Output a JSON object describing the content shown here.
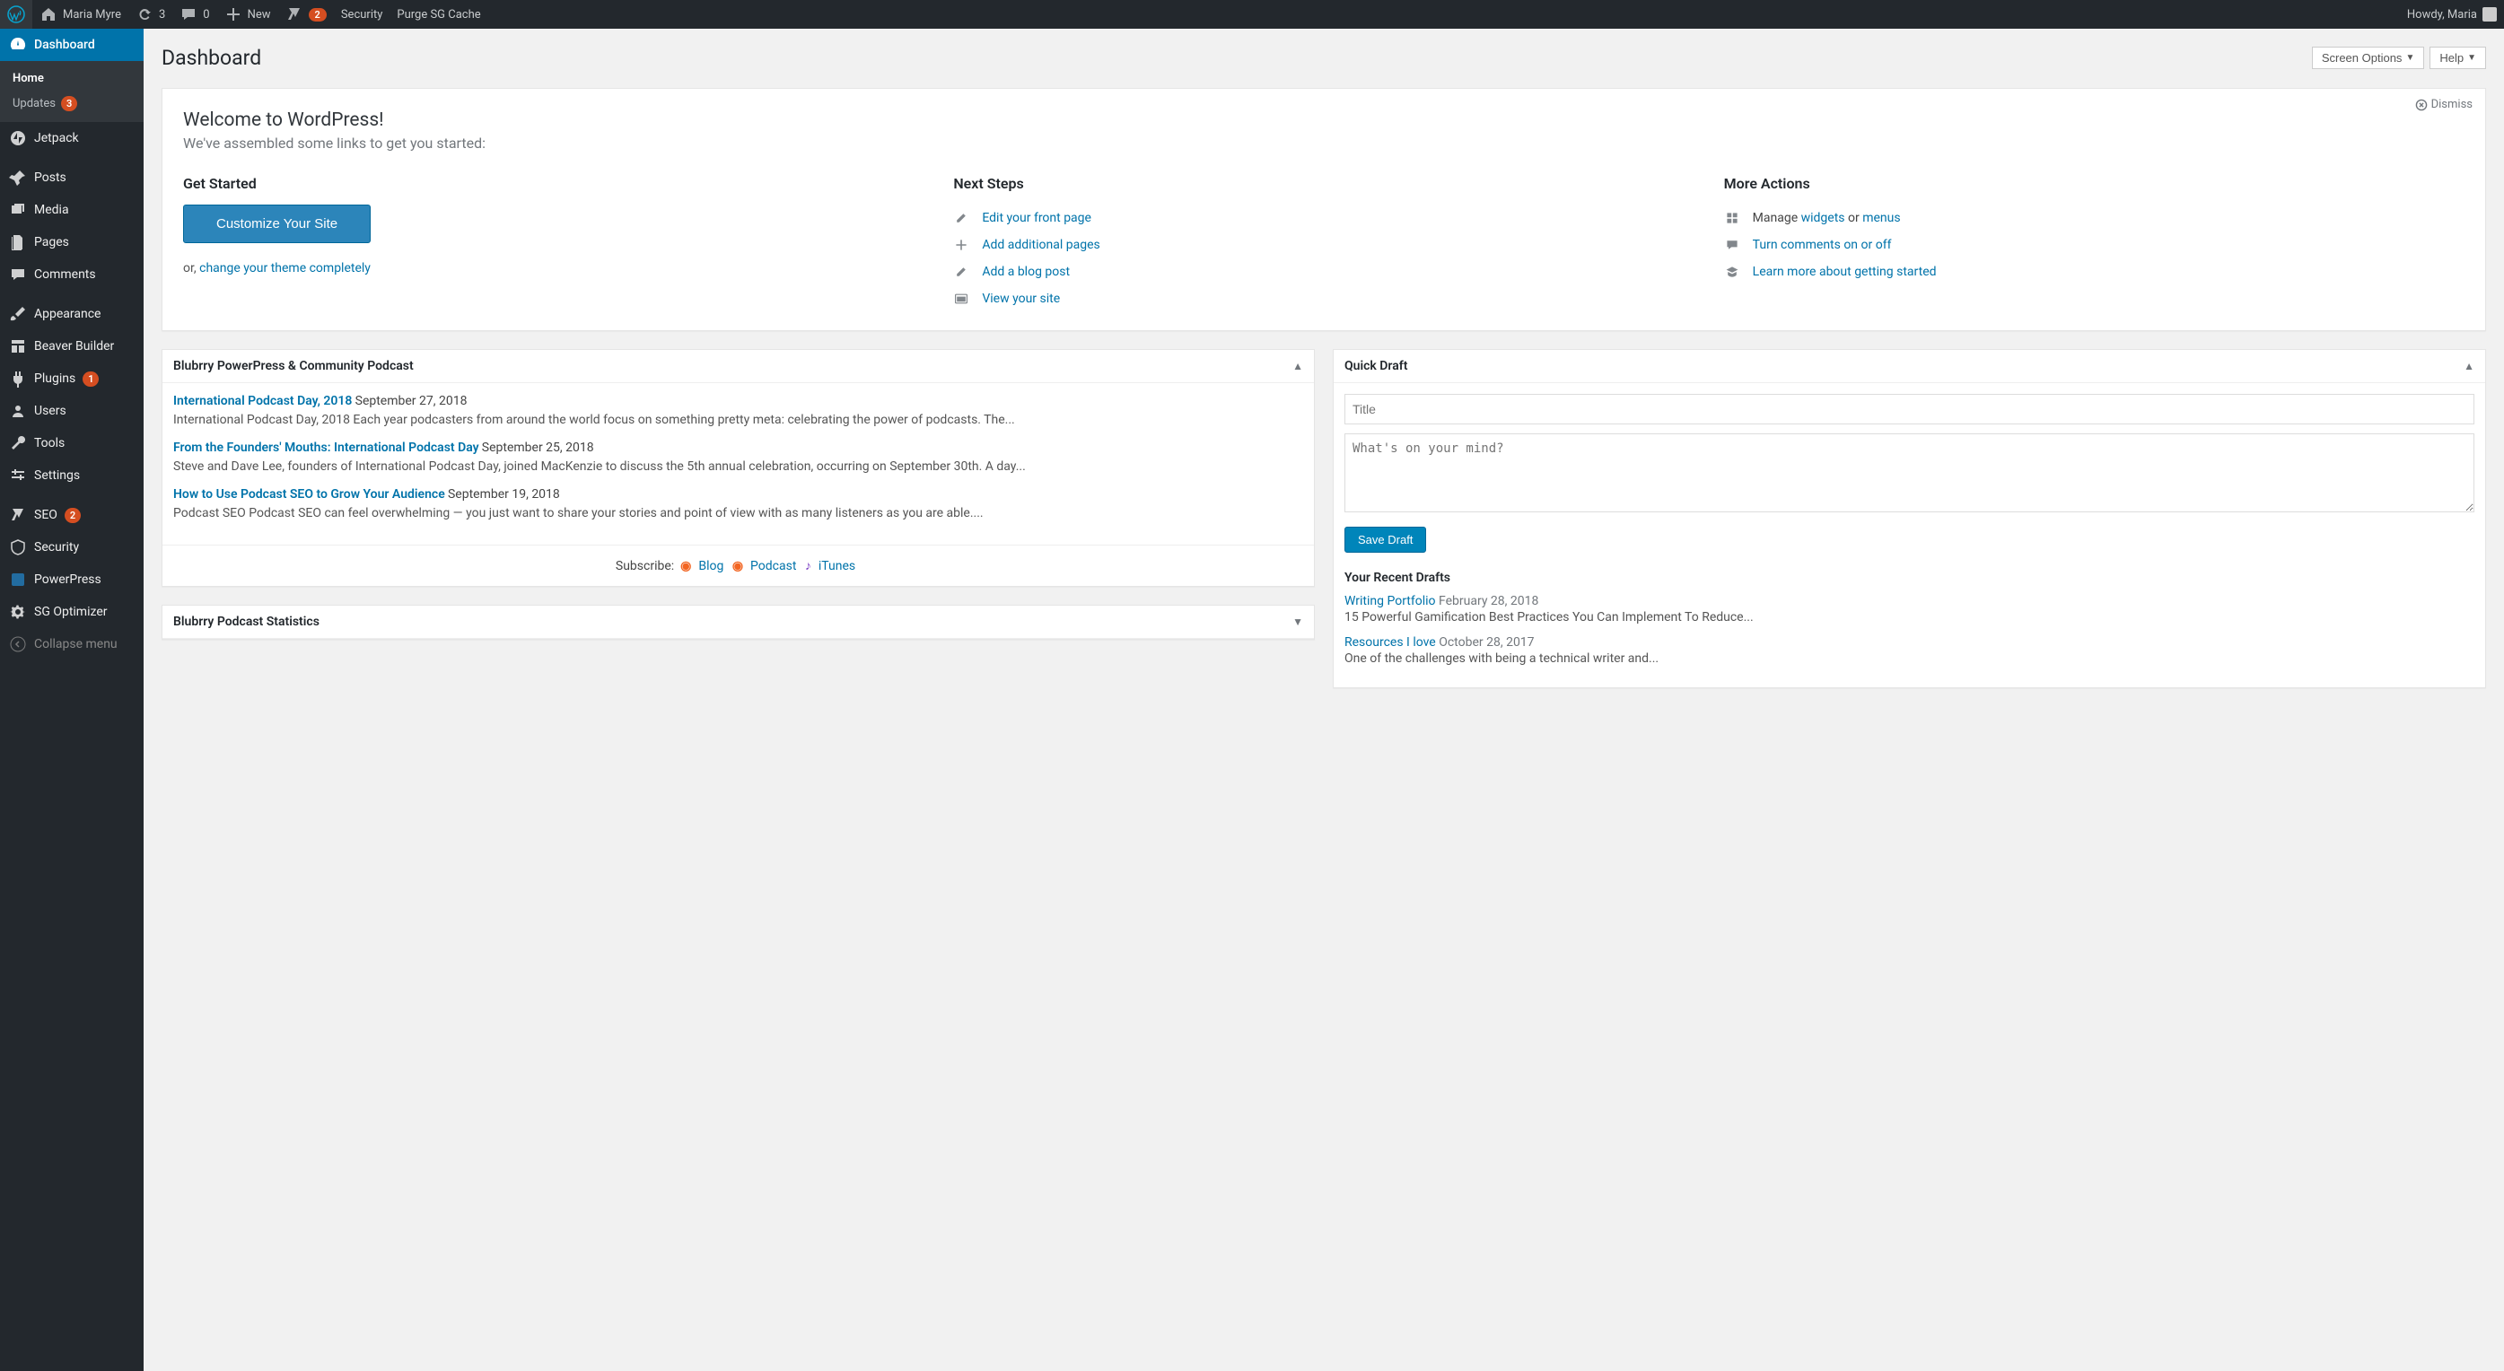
{
  "adminbar": {
    "site_name": "Maria Myre",
    "updates_count": "3",
    "comments_count": "0",
    "new_label": "New",
    "yoast_count": "2",
    "security_label": "Security",
    "purge_label": "Purge SG Cache",
    "howdy": "Howdy, Maria"
  },
  "sidebar": {
    "dashboard": "Dashboard",
    "home": "Home",
    "updates": "Updates",
    "updates_count": "3",
    "jetpack": "Jetpack",
    "posts": "Posts",
    "media": "Media",
    "pages": "Pages",
    "comments": "Comments",
    "appearance": "Appearance",
    "beaver": "Beaver Builder",
    "plugins": "Plugins",
    "plugins_count": "1",
    "users": "Users",
    "tools": "Tools",
    "settings": "Settings",
    "seo": "SEO",
    "seo_count": "2",
    "security2": "Security",
    "powerpress": "PowerPress",
    "sg": "SG Optimizer",
    "collapse": "Collapse menu"
  },
  "header": {
    "title": "Dashboard",
    "screen_options": "Screen Options",
    "help": "Help"
  },
  "welcome": {
    "title": "Welcome to WordPress!",
    "subtitle": "We've assembled some links to get you started:",
    "dismiss": "Dismiss",
    "get_started": "Get Started",
    "customize_btn": "Customize Your Site",
    "or_prefix": "or, ",
    "or_link": "change your theme completely",
    "next_steps": "Next Steps",
    "edit_front": "Edit your front page",
    "add_pages": "Add additional pages",
    "add_post": "Add a blog post",
    "view_site": "View your site",
    "more_actions": "More Actions",
    "manage_prefix": "Manage ",
    "widgets": "widgets",
    "or": " or ",
    "menus": "menus",
    "comments_toggle": "Turn comments on or off",
    "learn_more": "Learn more about getting started"
  },
  "blubrry": {
    "title": "Blubrry PowerPress & Community Podcast",
    "items": [
      {
        "title": "International Podcast Day, 2018",
        "date": "September 27, 2018",
        "excerpt": "International Podcast Day, 2018 Each year podcasters from around the world focus on something pretty meta: celebrating the power of podcasts. The..."
      },
      {
        "title": "From the Founders' Mouths: International Podcast Day",
        "date": "September 25, 2018",
        "excerpt": "Steve and Dave Lee, founders of International Podcast Day, joined MacKenzie to discuss the 5th annual celebration, occurring on September 30th. A day..."
      },
      {
        "title": "How to Use Podcast SEO to Grow Your Audience",
        "date": "September 19, 2018",
        "excerpt": "Podcast SEO Podcast SEO can feel overwhelming — you just want to share your stories and point of view with as many listeners as you are able...."
      }
    ],
    "subscribe_label": "Subscribe:",
    "sub_blog": "Blog",
    "sub_podcast": "Podcast",
    "sub_itunes": "iTunes"
  },
  "stats": {
    "title": "Blubrry Podcast Statistics"
  },
  "quickdraft": {
    "title": "Quick Draft",
    "title_placeholder": "Title",
    "content_placeholder": "What's on your mind?",
    "save": "Save Draft",
    "recent_title": "Your Recent Drafts",
    "drafts": [
      {
        "title": "Writing Portfolio",
        "date": "February 28, 2018",
        "excerpt": "15 Powerful Gamification Best Practices You Can Implement To Reduce..."
      },
      {
        "title": "Resources I love",
        "date": "October 28, 2017",
        "excerpt": "One of the challenges with being a technical writer and..."
      }
    ]
  }
}
